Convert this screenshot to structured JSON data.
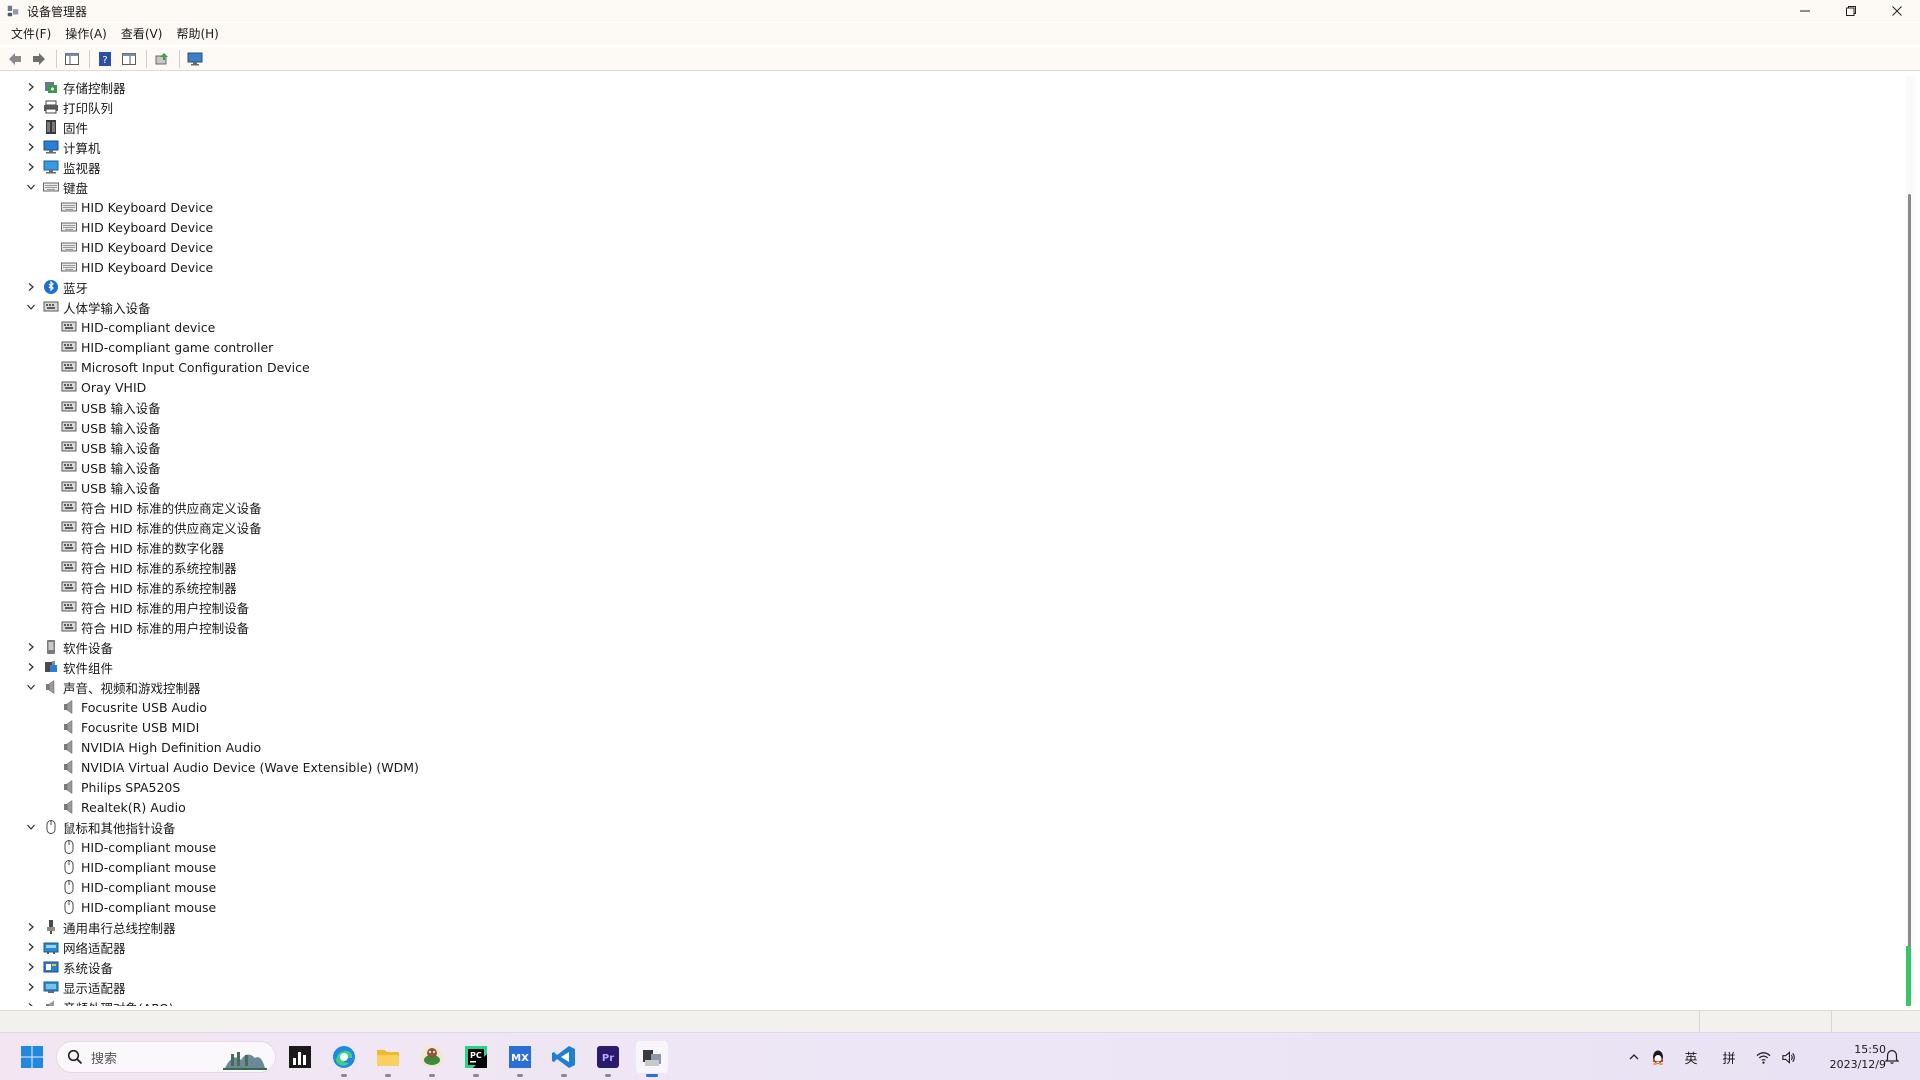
{
  "window": {
    "title": "设备管理器"
  },
  "menu": [
    {
      "label": "文件(F)"
    },
    {
      "label": "操作(A)"
    },
    {
      "label": "查看(V)"
    },
    {
      "label": "帮助(H)"
    }
  ],
  "toolbar": {
    "buttons": [
      "back-icon",
      "forward-icon",
      "properties-panel-icon",
      "help-icon",
      "details-panel-icon",
      "update-driver-icon",
      "monitor-scan-icon"
    ]
  },
  "tree": [
    {
      "level": 0,
      "expanded": false,
      "icon": "storage-controller-icon",
      "label": "存储控制器"
    },
    {
      "level": 0,
      "expanded": false,
      "icon": "printer-icon",
      "label": "打印队列"
    },
    {
      "level": 0,
      "expanded": false,
      "icon": "firmware-icon",
      "label": "固件"
    },
    {
      "level": 0,
      "expanded": false,
      "icon": "computer-icon",
      "label": "计算机"
    },
    {
      "level": 0,
      "expanded": false,
      "icon": "monitor-icon",
      "label": "监视器"
    },
    {
      "level": 0,
      "expanded": true,
      "icon": "keyboard-icon",
      "label": "键盘"
    },
    {
      "level": 1,
      "icon": "keyboard-icon",
      "label": "HID Keyboard Device"
    },
    {
      "level": 1,
      "icon": "keyboard-icon",
      "label": "HID Keyboard Device"
    },
    {
      "level": 1,
      "icon": "keyboard-icon",
      "label": "HID Keyboard Device"
    },
    {
      "level": 1,
      "icon": "keyboard-icon",
      "label": "HID Keyboard Device"
    },
    {
      "level": 0,
      "expanded": false,
      "icon": "bluetooth-icon",
      "label": "蓝牙"
    },
    {
      "level": 0,
      "expanded": true,
      "icon": "hid-icon",
      "label": "人体学输入设备"
    },
    {
      "level": 1,
      "icon": "hid-icon",
      "label": "HID-compliant device"
    },
    {
      "level": 1,
      "icon": "hid-icon",
      "label": "HID-compliant game controller"
    },
    {
      "level": 1,
      "icon": "hid-icon",
      "label": "Microsoft Input Configuration Device"
    },
    {
      "level": 1,
      "icon": "hid-icon",
      "label": "Oray VHID"
    },
    {
      "level": 1,
      "icon": "hid-icon",
      "label": "USB 输入设备"
    },
    {
      "level": 1,
      "icon": "hid-icon",
      "label": "USB 输入设备"
    },
    {
      "level": 1,
      "icon": "hid-icon",
      "label": "USB 输入设备"
    },
    {
      "level": 1,
      "icon": "hid-icon",
      "label": "USB 输入设备"
    },
    {
      "level": 1,
      "icon": "hid-icon",
      "label": "USB 输入设备"
    },
    {
      "level": 1,
      "icon": "hid-icon",
      "label": "符合 HID 标准的供应商定义设备"
    },
    {
      "level": 1,
      "icon": "hid-icon",
      "label": "符合 HID 标准的供应商定义设备"
    },
    {
      "level": 1,
      "icon": "hid-icon",
      "label": "符合 HID 标准的数字化器"
    },
    {
      "level": 1,
      "icon": "hid-icon",
      "label": "符合 HID 标准的系统控制器"
    },
    {
      "level": 1,
      "icon": "hid-icon",
      "label": "符合 HID 标准的系统控制器"
    },
    {
      "level": 1,
      "icon": "hid-icon",
      "label": "符合 HID 标准的用户控制设备"
    },
    {
      "level": 1,
      "icon": "hid-icon",
      "label": "符合 HID 标准的用户控制设备"
    },
    {
      "level": 0,
      "expanded": false,
      "icon": "software-device-icon",
      "label": "软件设备"
    },
    {
      "level": 0,
      "expanded": false,
      "icon": "software-component-icon",
      "label": "软件组件"
    },
    {
      "level": 0,
      "expanded": true,
      "icon": "speaker-icon",
      "label": "声音、视频和游戏控制器"
    },
    {
      "level": 1,
      "icon": "speaker-icon",
      "label": "Focusrite USB Audio"
    },
    {
      "level": 1,
      "icon": "speaker-icon",
      "label": "Focusrite USB MIDI"
    },
    {
      "level": 1,
      "icon": "speaker-icon",
      "label": "NVIDIA High Definition Audio"
    },
    {
      "level": 1,
      "icon": "speaker-icon",
      "label": "NVIDIA Virtual Audio Device (Wave Extensible) (WDM)"
    },
    {
      "level": 1,
      "icon": "speaker-icon",
      "label": "Philips SPA520S"
    },
    {
      "level": 1,
      "icon": "speaker-icon",
      "label": "Realtek(R) Audio"
    },
    {
      "level": 0,
      "expanded": true,
      "icon": "mouse-icon",
      "label": "鼠标和其他指针设备"
    },
    {
      "level": 1,
      "icon": "mouse-icon",
      "label": "HID-compliant mouse"
    },
    {
      "level": 1,
      "icon": "mouse-icon",
      "label": "HID-compliant mouse"
    },
    {
      "level": 1,
      "icon": "mouse-icon",
      "label": "HID-compliant mouse"
    },
    {
      "level": 1,
      "icon": "mouse-icon",
      "label": "HID-compliant mouse"
    },
    {
      "level": 0,
      "expanded": false,
      "icon": "usb-controller-icon",
      "label": "通用串行总线控制器"
    },
    {
      "level": 0,
      "expanded": false,
      "icon": "network-adapter-icon",
      "label": "网络适配器"
    },
    {
      "level": 0,
      "expanded": false,
      "icon": "system-device-icon",
      "label": "系统设备"
    },
    {
      "level": 0,
      "expanded": false,
      "icon": "display-adapter-icon",
      "label": "显示适配器"
    },
    {
      "level": 0,
      "expanded": false,
      "icon": "audio-processing-icon",
      "label": "音频处理对象(APO)"
    }
  ],
  "taskbar": {
    "search_placeholder": "搜索",
    "apps": [
      {
        "name": "task-manager-icon",
        "color": "#1a1a1a"
      },
      {
        "name": "edge-icon",
        "color": "#1f8ae0"
      },
      {
        "name": "file-explorer-icon",
        "color": "#f2b830"
      },
      {
        "name": "chrome-like-icon",
        "color": "#3b8a3a"
      },
      {
        "name": "pycharm-icon",
        "color": "#21d789"
      },
      {
        "name": "mx-icon",
        "color": "#2a6fd6"
      },
      {
        "name": "vscode-icon",
        "color": "#1f7fd4"
      },
      {
        "name": "premiere-icon",
        "color": "#2a1a6b"
      },
      {
        "name": "device-manager-icon",
        "color": "#3a3a3a"
      }
    ],
    "tray": {
      "ime_lang": "英",
      "ime_mode": "拼",
      "time": "15:50",
      "date": "2023/12/9"
    }
  },
  "colors": {
    "accent": "#2a6fd6",
    "scroll_marker": "#38c46a"
  }
}
